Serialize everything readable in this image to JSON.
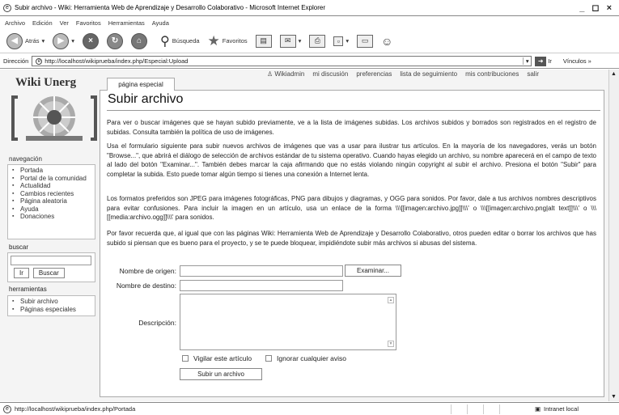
{
  "window": {
    "title": "Subir archivo - Wiki: Herramienta Web de Aprendizaje y Desarrollo Colaborativo - Microsoft Internet Explorer",
    "controls": "_ ◻ ×"
  },
  "menu": [
    "Archivo",
    "Edición",
    "Ver",
    "Favoritos",
    "Herramientas",
    "Ayuda"
  ],
  "toolbar": {
    "back": "Atrás",
    "search": "Búsqueda",
    "favorites": "Favoritos"
  },
  "address": {
    "label": "Dirección",
    "url": "http://localhost/wikiprueba/index.php/Especial:Upload",
    "go": "Ir",
    "links": "Vínculos"
  },
  "personal": [
    "Wikiadmin",
    "mi discusión",
    "preferencias",
    "lista de seguimiento",
    "mis contribuciones",
    "salir"
  ],
  "logo": {
    "text": "Wiki Unerg"
  },
  "sidebar": {
    "nav_heading": "navegación",
    "nav": [
      "Portada",
      "Portal de la comunidad",
      "Actualidad",
      "Cambios recientes",
      "Página aleatoria",
      "Ayuda",
      "Donaciones"
    ],
    "search_heading": "buscar",
    "go_button": "Ir",
    "search_button": "Buscar",
    "tools_heading": "herramientas",
    "tools": [
      "Subir archivo",
      "Páginas especiales"
    ]
  },
  "tab": "página especial",
  "page": {
    "title": "Subir archivo",
    "p1": "Para ver o buscar imágenes que se hayan subido previamente, ve a la lista de imágenes subidas. Los archivos subidos y borrados son registrados en el registro de subidas. Consulta también la política de uso de imágenes.",
    "p2": "Usa el formulario siguiente para subir nuevos archivos de imágenes que vas a usar para ilustrar tus artículos. En la mayoría de los navegadores, verás un botón \"Browse...\", que abrirá el diálogo de selección de archivos estándar de tu sistema operativo. Cuando hayas elegido un archivo, su nombre aparecerá en el campo de texto al lado del botón \"Examinar...\". También debes marcar la caja afirmando que no estás violando ningún copyright al subir el archivo. Presiona el botón \"Subir\" para completar la subida. Esto puede tomar algún tiempo si tienes una conexión a Internet lenta.",
    "p3": "Los formatos preferidos son JPEG para imágenes fotográficas, PNG para dibujos y diagramas, y OGG para sonidos. Por favor, dale a tus archivos nombres descriptivos para evitar confusiones. Para incluir la imagen en un artículo, usa un enlace de la forma \\\\\\[[imagen:archivo.jpg]]\\\\\\' o \\\\\\[[imagen:archivo.png|alt text]]\\\\\\' o \\\\\\[[media:archivo.ogg]]\\\\\\' para sonidos.",
    "p4": "Por favor recuerda que, al igual que con las páginas Wiki: Herramienta Web de Aprendizaje y Desarrollo Colaborativo, otros pueden editar o borrar los archivos que has subido si piensan que es bueno para el proyecto, y se te puede bloquear, impidiéndote subir más archivos si abusas del sistema."
  },
  "form": {
    "origin_label": "Nombre de origen:",
    "browse_button": "Examinar...",
    "dest_label": "Nombre de destino:",
    "desc_label": "Descripción:",
    "watch_label": "Vigilar este artículo",
    "ignore_label": "Ignorar cualquier aviso",
    "submit_button": "Subir un archivo"
  },
  "status": {
    "url": "http://localhost/wikiprueba/index.php/Portada",
    "zone": "Intranet local"
  }
}
